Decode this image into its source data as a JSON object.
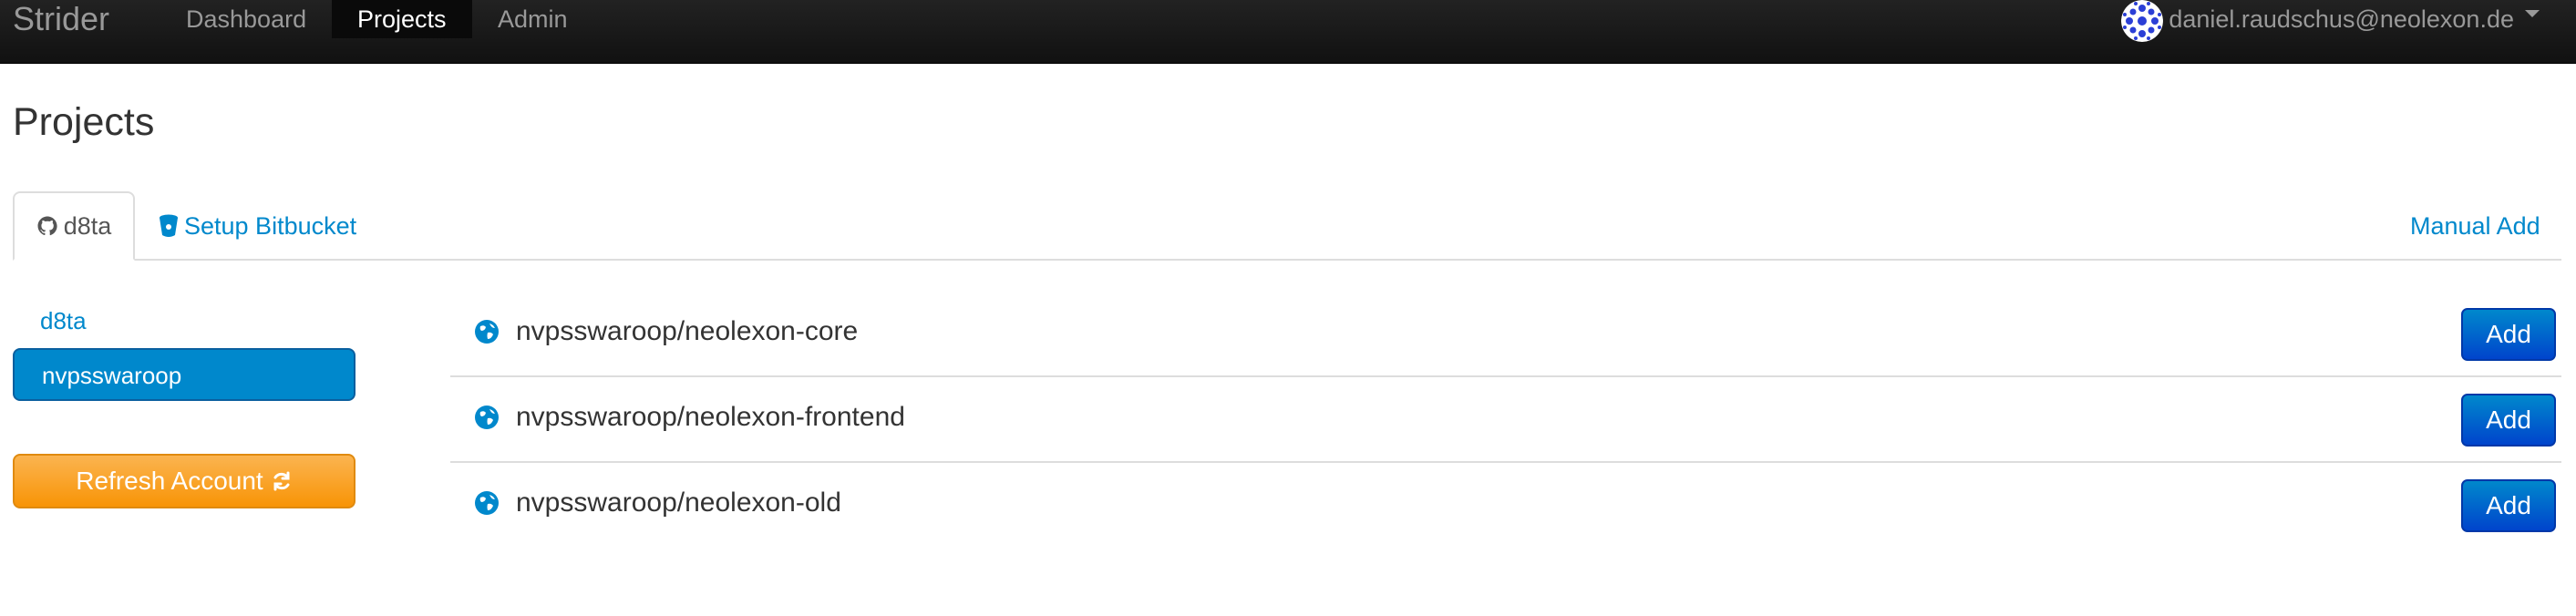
{
  "navbar": {
    "brand": "Strider",
    "links": [
      {
        "label": "Dashboard",
        "active": false
      },
      {
        "label": "Projects",
        "active": true
      },
      {
        "label": "Admin",
        "active": false
      }
    ],
    "user_email": "daniel.raudschus@neolexon.de"
  },
  "page": {
    "title": "Projects"
  },
  "tabs": {
    "account_tab": {
      "label": "d8ta",
      "icon": "github-icon"
    },
    "setup_tab": {
      "label": "Setup Bitbucket",
      "icon": "bitbucket-icon"
    },
    "manual_add": "Manual Add"
  },
  "sidebar": {
    "accounts": [
      {
        "label": "d8ta",
        "active": false
      },
      {
        "label": "nvpsswaroop",
        "active": true
      }
    ],
    "refresh_label": "Refresh Account",
    "refresh_icon": "refresh-icon"
  },
  "repos": [
    {
      "name": "nvpsswaroop/neolexon-core",
      "visibility_icon": "globe-icon",
      "action": "Add"
    },
    {
      "name": "nvpsswaroop/neolexon-frontend",
      "visibility_icon": "globe-icon",
      "action": "Add"
    },
    {
      "name": "nvpsswaroop/neolexon-old",
      "visibility_icon": "globe-icon",
      "action": "Add"
    }
  ],
  "colors": {
    "navbar_bg": "#1b1b1b",
    "link": "#0088cc",
    "primary_button": "#0055cc",
    "warning_button": "#f89406"
  }
}
